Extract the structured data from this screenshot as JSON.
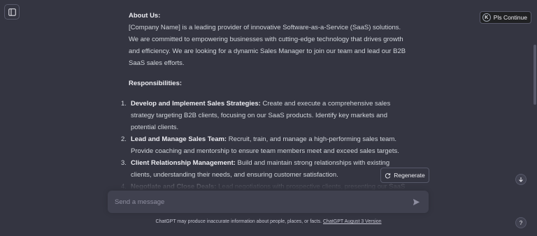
{
  "header": {
    "extension_badge": "K",
    "extension_button_label": "Pls Continue"
  },
  "message": {
    "about_title": "About Us:",
    "about_text": "[Company Name] is a leading provider of innovative Software-as-a-Service (SaaS) solutions. We are committed to empowering businesses with cutting-edge technology that drives growth and efficiency. We are looking for a dynamic Sales Manager to join our team and lead our B2B SaaS sales efforts.",
    "responsibilities_title": "Responsibilities:",
    "responsibilities": [
      {
        "number": "1.",
        "heading": "Develop and Implement Sales Strategies:",
        "text": " Create and execute a comprehensive sales strategy targeting B2B clients, focusing on our SaaS products. Identify key markets and potential clients."
      },
      {
        "number": "2.",
        "heading": "Lead and Manage Sales Team:",
        "text": " Recruit, train, and manage a high-performing sales team. Provide coaching and mentorship to ensure team members meet and exceed sales targets."
      },
      {
        "number": "3.",
        "heading": "Client Relationship Management:",
        "text": " Build and maintain strong relationships with existing clients, understanding their needs, and ensuring customer satisfaction."
      },
      {
        "number": "4.",
        "heading": "Negotiate and Close Deals:",
        "text": " Lead negotiations with prospective clients, presenting our SaaS"
      }
    ]
  },
  "actions": {
    "regenerate_label": "Regenerate"
  },
  "composer": {
    "placeholder": "Send a message",
    "value": ""
  },
  "footer": {
    "disclaimer": "ChatGPT may produce inaccurate information about people, places, or facts. ",
    "version_link": "ChatGPT August 3 Version"
  },
  "help": {
    "label": "?"
  },
  "colors": {
    "background": "#343541",
    "input_background": "#40414f",
    "text": "#d1d5db",
    "border": "#565869"
  },
  "icons": {
    "sidebar_toggle": "sidebar-toggle-icon",
    "regenerate": "refresh-icon",
    "send": "send-icon",
    "scroll_down": "arrow-down-icon"
  }
}
